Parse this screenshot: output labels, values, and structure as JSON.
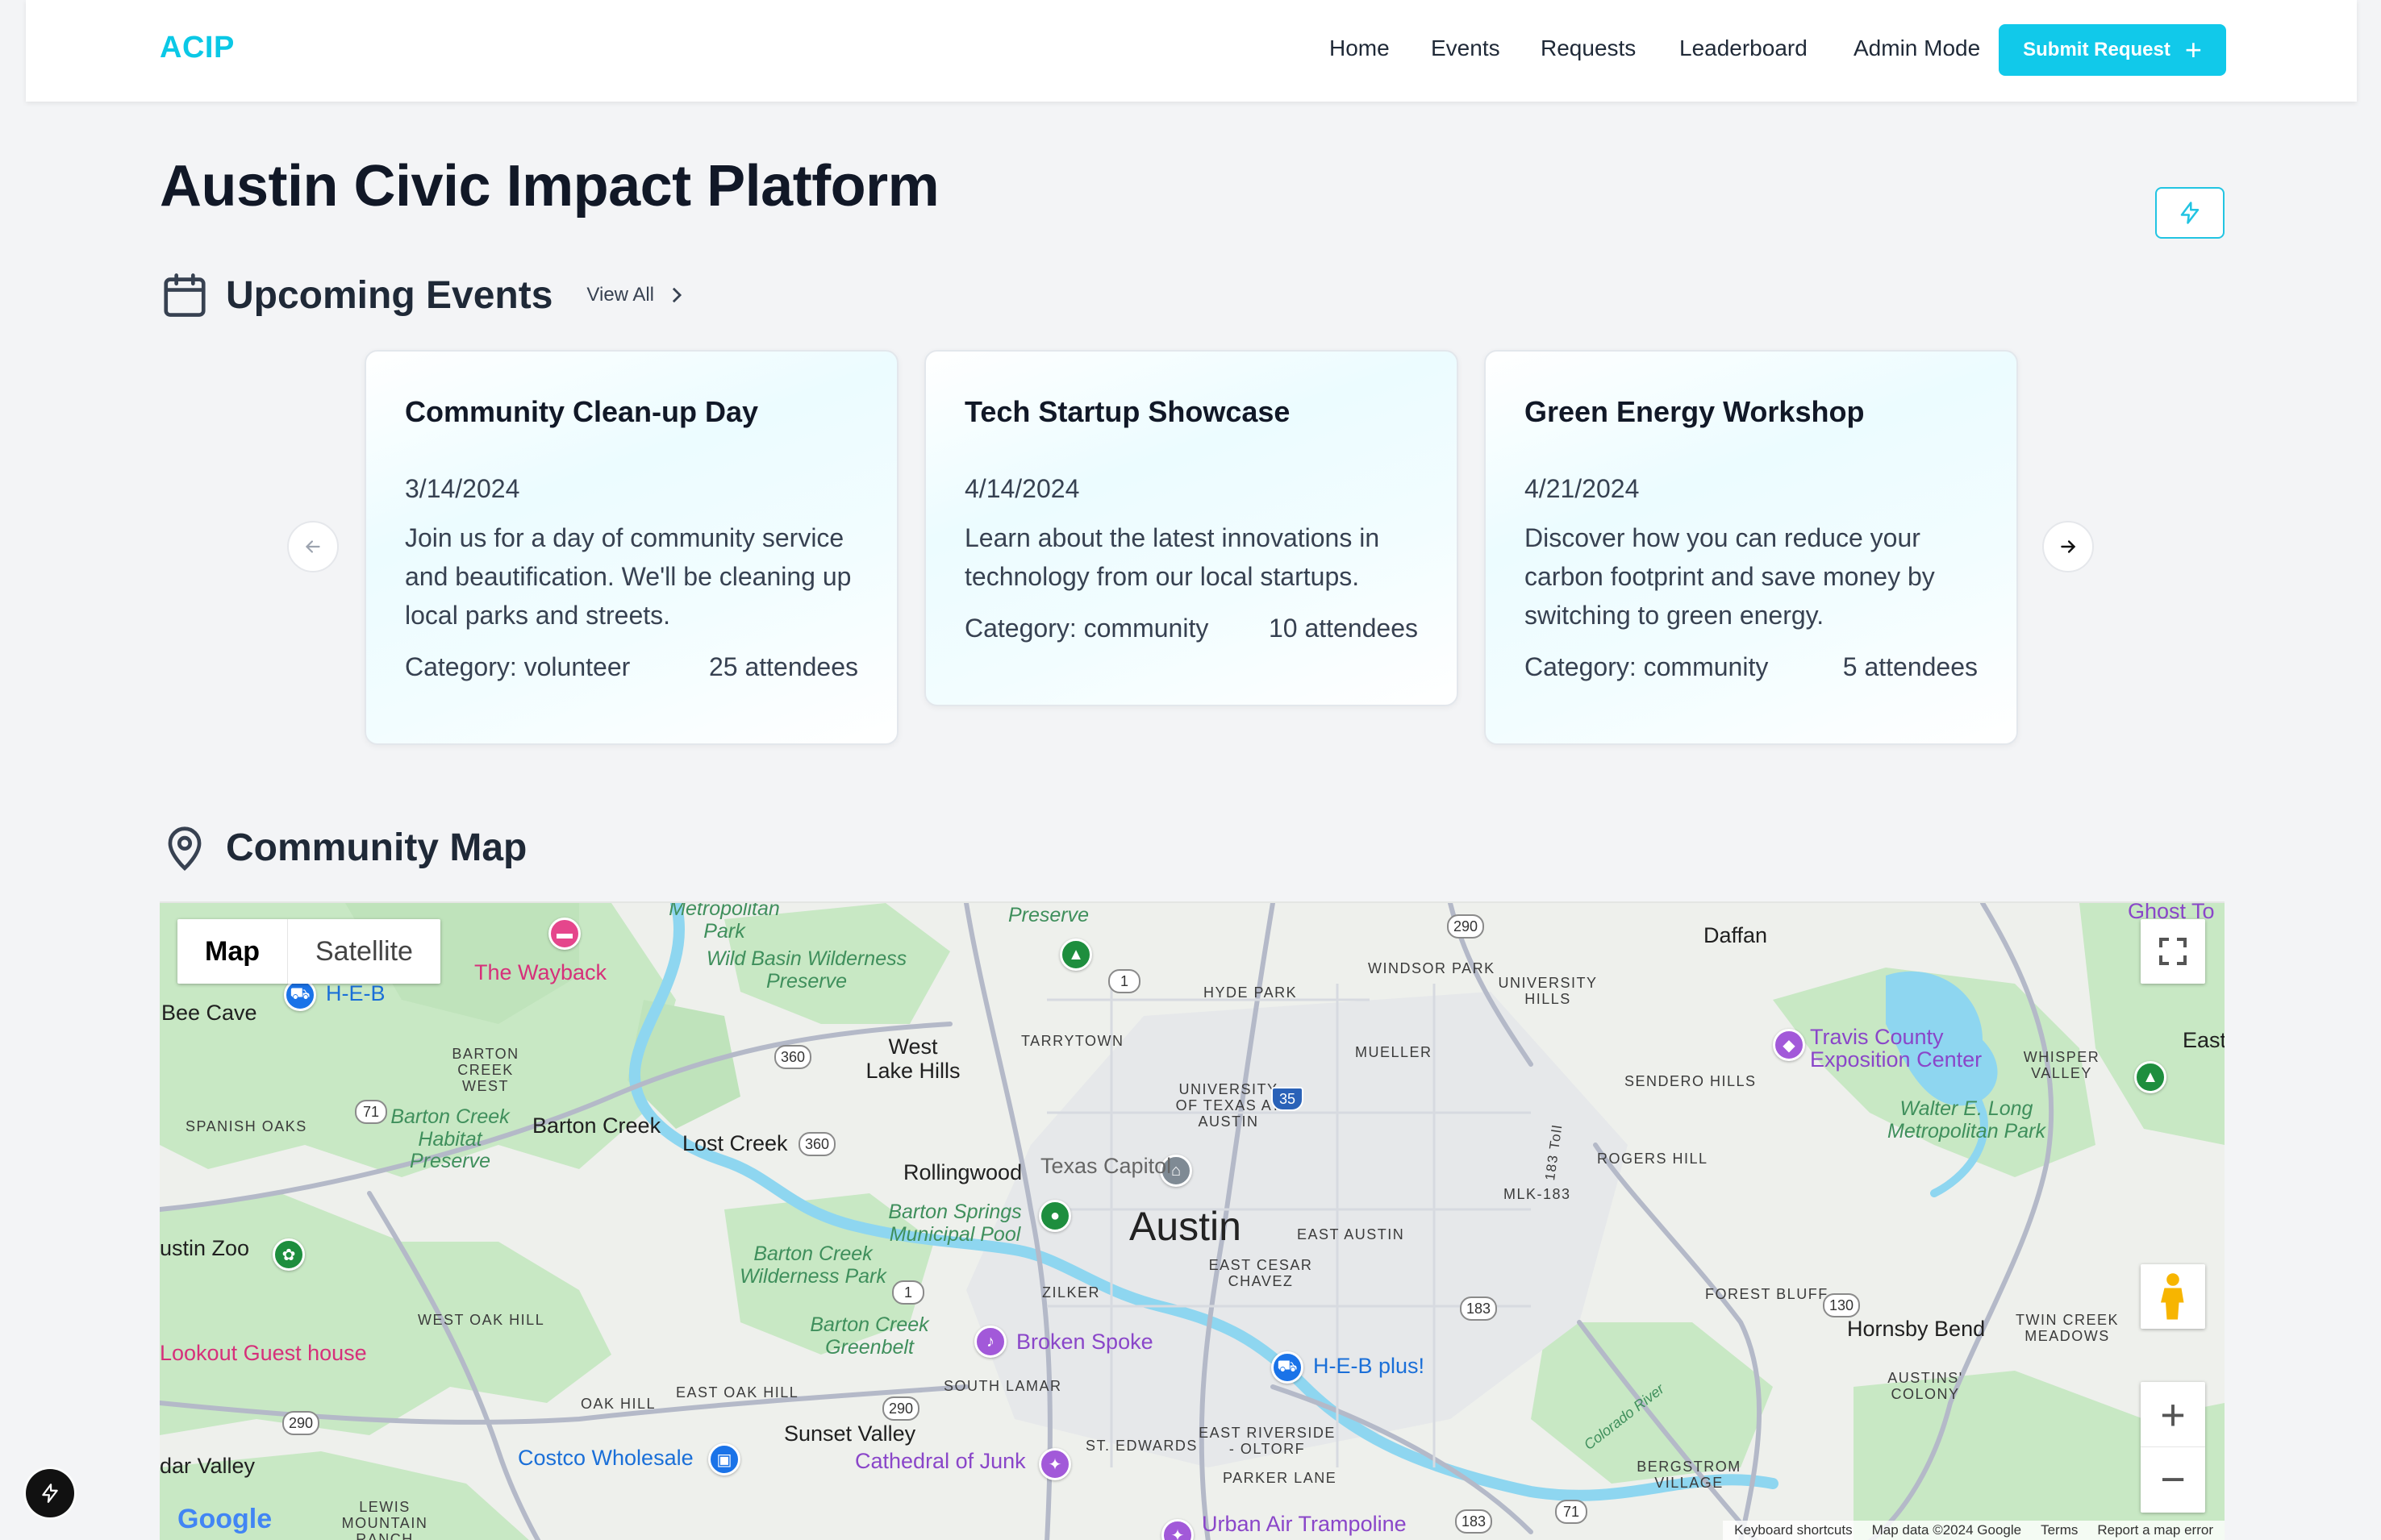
{
  "header": {
    "logo": "ACIP",
    "nav": [
      "Home",
      "Events",
      "Requests",
      "Leaderboard",
      "Admin Mode"
    ],
    "submit_label": "Submit Request"
  },
  "page_title": "Austin Civic Impact Platform",
  "events": {
    "title": "Upcoming Events",
    "view_all": "View All",
    "cards": [
      {
        "title": "Community Clean-up Day",
        "date": "3/14/2024",
        "description": "Join us for a day of community service and beautification. We'll be cleaning up local parks and streets.",
        "category": "Category: volunteer",
        "attendees": "25 attendees"
      },
      {
        "title": "Tech Startup Showcase",
        "date": "4/14/2024",
        "description": "Learn about the latest innovations in technology from our local startups.",
        "category": "Category: community",
        "attendees": "10 attendees"
      },
      {
        "title": "Green Energy Workshop",
        "date": "4/21/2024",
        "description": "Discover how you can reduce your carbon footprint and save money by switching to green energy.",
        "category": "Category: community",
        "attendees": "5 attendees"
      }
    ]
  },
  "map": {
    "title": "Community Map",
    "type_map": "Map",
    "type_satellite": "Satellite",
    "city": "Austin",
    "towns": [
      "Bee Cave",
      "West Lake Hills",
      "Barton Creek",
      "Lost Creek",
      "Rollingwood",
      "Sunset Valley",
      "Daffan",
      "Hornsby Bend",
      "ustin Zoo",
      "dar Valley",
      "East"
    ],
    "hoods": [
      "BARTON CREEK WEST",
      "SPANISH OAKS",
      "TARRYTOWN",
      "HYDE PARK",
      "WINDSOR PARK",
      "UNIVERSITY HILLS",
      "MUELLER",
      "UNIVERSITY OF TEXAS AT AUSTIN",
      "SENDERO HILLS",
      "WHISPER VALLEY",
      "ROGERS HILL",
      "MLK-183",
      "EAST AUSTIN",
      "EAST CESAR CHAVEZ",
      "ZILKER",
      "WEST OAK HILL",
      "SOUTH LAMAR",
      "EAST OAK HILL",
      "OAK HILL",
      "ST. EDWARDS",
      "EAST RIVERSIDE - OLTORF",
      "PARKER LANE",
      "FOREST BLUFF",
      "TWIN CREEK MEADOWS",
      "AUSTINS' COLONY",
      "BERGSTROM VILLAGE",
      "LEWIS MOUNTAIN RANCH"
    ],
    "parks": [
      "Metropolitan Park",
      "Wild Basin Wilderness Preserve",
      "Barton Creek Habitat Preserve",
      "Barton Springs Municipal Pool",
      "Barton Creek Wilderness Park",
      "Barton Creek Greenbelt",
      "Walter E. Long Metropolitan Park",
      "Preserve"
    ],
    "pois": {
      "wayback": "The Wayback",
      "heb": "H-E-B",
      "travis": "Travis County Exposition Center",
      "capitol": "Texas Capitol",
      "broken_spoke": "Broken Spoke",
      "heb_plus": "H-E-B plus!",
      "costco": "Costco Wholesale",
      "cathedral": "Cathedral of Junk",
      "lookout": "Lookout Guest house",
      "urban_air": "Urban Air Trampoline",
      "ghost": "Ghost To",
      "colorado": "Colorado River",
      "toll": "183 Toll"
    },
    "highways": [
      "290",
      "1",
      "360",
      "71",
      "35",
      "183",
      "130",
      "290",
      "290",
      "183",
      "71",
      "360",
      "1"
    ],
    "attribution": [
      "Keyboard shortcuts",
      "Map data ©2024 Google",
      "Terms",
      "Report a map error"
    ],
    "google": "Google"
  },
  "colors": {
    "accent": "#11c9ea",
    "logo": "#0bc8e6",
    "page_bg": "#f3f4f6",
    "map_green": "#c8e8c4",
    "water": "#8ed6f0"
  }
}
